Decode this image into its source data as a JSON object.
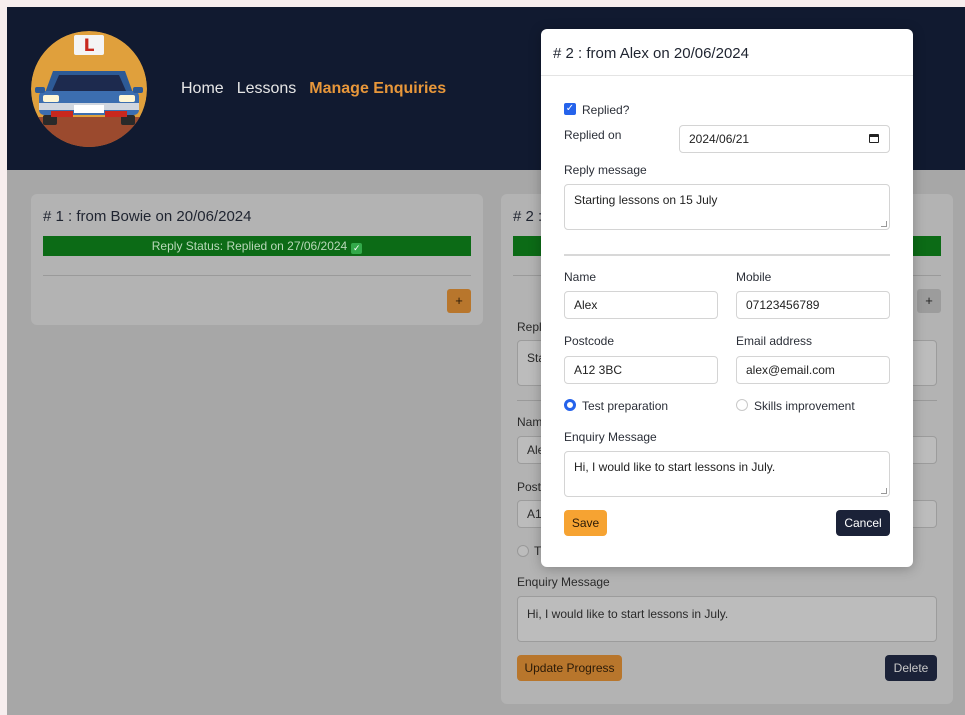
{
  "header": {
    "logo_letter": "L",
    "nav": [
      {
        "label": "Home"
      },
      {
        "label": "Lessons"
      },
      {
        "label": "Manage Enquiries"
      }
    ]
  },
  "cards": [
    {
      "title": "# 1 : from Bowie on 20/06/2024",
      "status": "Reply Status: Replied on 27/06/2024",
      "expand_label": "+"
    },
    {
      "title": "# 2 :",
      "expand_label": "+",
      "fragments": {
        "replied": "Repl",
        "reply_text": "Sta",
        "name": "Nam",
        "name_value": "Ale",
        "postcode": "Post",
        "postcode_value": "A1",
        "radio": "T"
      },
      "enquiry_label": "Enquiry Message",
      "enquiry_value": "Hi, I would like to start lessons in July.",
      "update_label": "Update Progress",
      "delete_label": "Delete"
    }
  ],
  "modal": {
    "title": "# 2 : from Alex on 20/06/2024",
    "replied_label": "Replied?",
    "replied_checked": true,
    "replied_on_label": "Replied on",
    "replied_on_value": "2024/06/21",
    "reply_message_label": "Reply message",
    "reply_message_value": "Starting lessons on 15 July",
    "name_label": "Name",
    "name_value": "Alex",
    "mobile_label": "Mobile",
    "mobile_value": "07123456789",
    "postcode_label": "Postcode",
    "postcode_value": "A12 3BC",
    "email_label": "Email address",
    "email_value": "alex@email.com",
    "radio_options": [
      {
        "label": "Test preparation",
        "selected": true
      },
      {
        "label": "Skills improvement",
        "selected": false
      }
    ],
    "enquiry_label": "Enquiry Message",
    "enquiry_value": "Hi, I would like to start lessons in July.",
    "save_label": "Save",
    "cancel_label": "Cancel"
  },
  "colors": {
    "header_bg": "#111a30",
    "accent_orange": "#e8973a",
    "status_green": "#0c6b16",
    "primary_blue": "#2563eb",
    "dark_button": "#1b2238"
  }
}
